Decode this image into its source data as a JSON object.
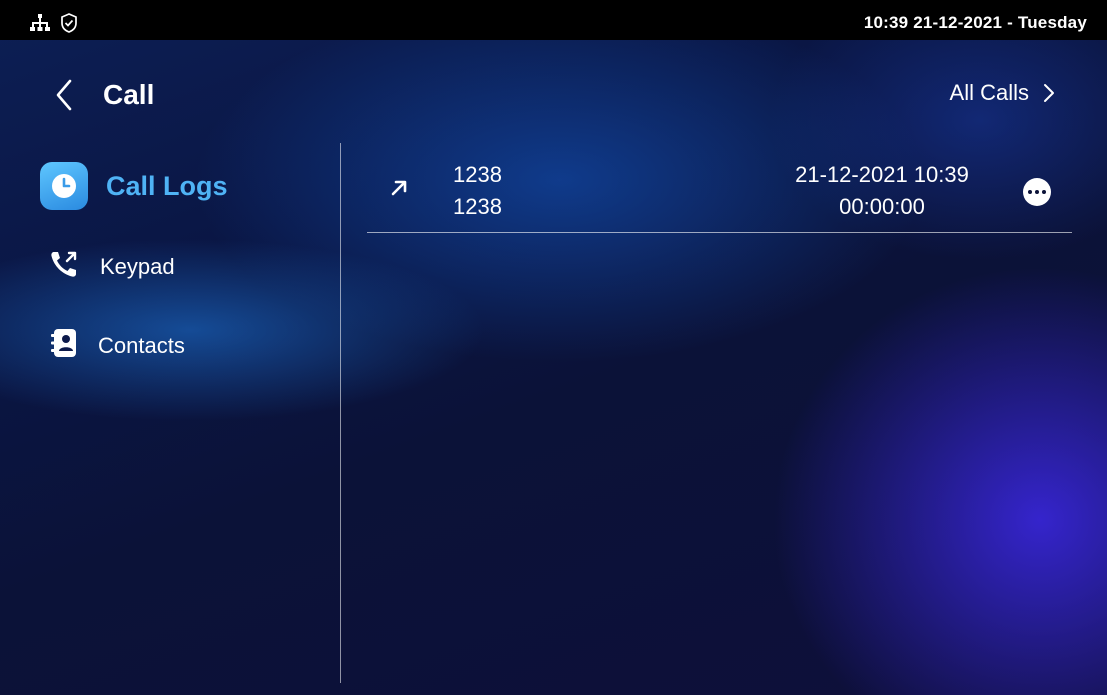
{
  "status_bar": {
    "datetime": "10:39  21-12-2021 - Tuesday",
    "icons": [
      "network-icon",
      "shield-check-icon"
    ]
  },
  "header": {
    "title": "Call",
    "back_icon": "chevron-left-icon",
    "all_calls_label": "All Calls",
    "all_calls_icon": "chevron-right-icon"
  },
  "sidebar": {
    "items": [
      {
        "label": "Call Logs",
        "icon": "clock-icon",
        "active": true
      },
      {
        "label": "Keypad",
        "icon": "phone-outgoing-icon",
        "active": false
      },
      {
        "label": "Contacts",
        "icon": "contact-book-icon",
        "active": false
      }
    ]
  },
  "call_logs": [
    {
      "direction": "outgoing",
      "name": "1238",
      "number": "1238",
      "datetime": "21-12-2021 10:39",
      "duration": "00:00:00"
    }
  ],
  "colors": {
    "accent": "#4fb3f5",
    "statusbar": "#000000",
    "background": "#0a0f2e"
  }
}
